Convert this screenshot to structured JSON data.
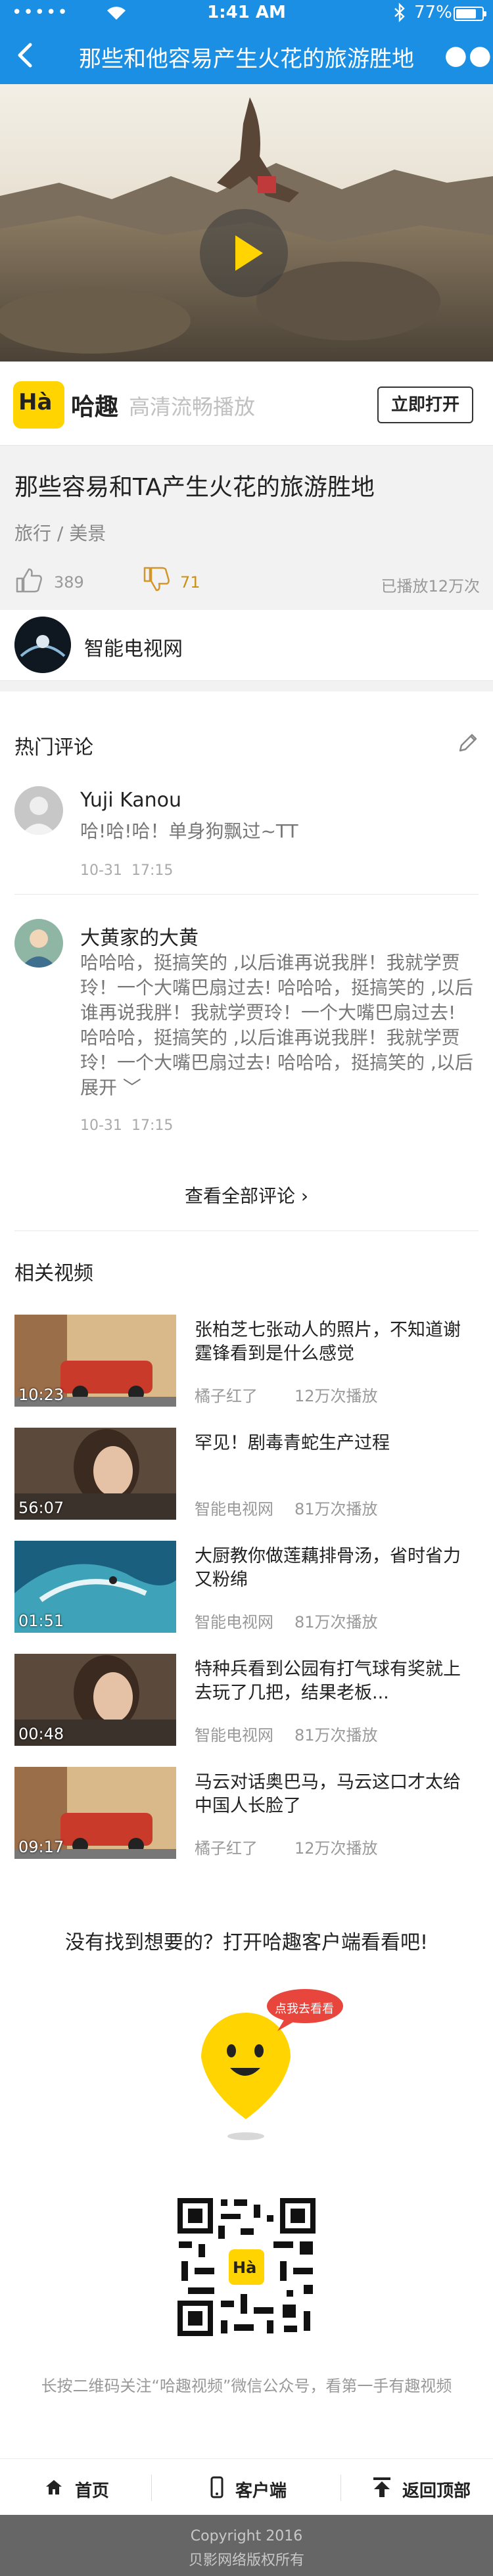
{
  "status_bar": {
    "carrier": "•••••",
    "time": "1:41 AM",
    "battery": "77%"
  },
  "nav": {
    "title": "那些和他容易产生火花的旅游胜地"
  },
  "app_banner": {
    "brand": "哈趣",
    "logo_text": "Hà",
    "slogan": "高清流畅播放",
    "open_label": "立即打开"
  },
  "video_info": {
    "title": "那些容易和TA产生火花的旅游胜地",
    "category": "旅行 / 美景",
    "likes": "389",
    "dislikes": "71",
    "plays": "已播放12万次"
  },
  "channel": {
    "name": "智能电视网"
  },
  "comments": {
    "heading": "热门评论",
    "items": [
      {
        "user": "Yuji Kanou",
        "text": "哈!哈!哈！单身狗飘过~TT",
        "date": "10-31",
        "time": "17:15"
      },
      {
        "user": "大黄家的大黄",
        "text": "哈哈哈，挺搞笑的 ,以后谁再说我胖！我就学贾玲！一个大嘴巴扇过去! 哈哈哈，挺搞笑的 ,以后谁再说我胖！我就学贾玲！一个大嘴巴扇过去!　哈哈哈，挺搞笑的 ,以后谁再说我胖！我就学贾玲！一个大嘴巴扇过去! 哈哈哈，挺搞笑的 ,以后谁再说我胖！",
        "expand": "展开",
        "date": "10-31",
        "time": "17:15"
      }
    ],
    "see_all": "查看全部评论"
  },
  "related": {
    "heading": "相关视频",
    "items": [
      {
        "title": "张柏芝七张动人的照片，不知道谢霆锋看到是什么感觉",
        "duration": "10:23",
        "source": "橘子红了",
        "plays": "12万次播放"
      },
      {
        "title": "罕见！剧毒青蛇生产过程",
        "duration": "56:07",
        "source": "智能电视网",
        "plays": "81万次播放"
      },
      {
        "title": "大厨教你做莲藕排骨汤，省时省力又粉绵",
        "duration": "01:51",
        "source": "智能电视网",
        "plays": "81万次播放"
      },
      {
        "title": "特种兵看到公园有打气球有奖就上去玩了几把，结果老板...",
        "duration": "00:48",
        "source": "智能电视网",
        "plays": "81万次播放"
      },
      {
        "title": "马云对话奥巴马，马云这口才太给中国人长脸了",
        "duration": "09:17",
        "source": "橘子红了",
        "plays": "12万次播放"
      }
    ]
  },
  "promo": {
    "text": "没有找到想要的？打开哈趣客户端看看吧!",
    "bubble": "点我去看看",
    "qr_caption": "长按二维码关注“哈趣视频”微信公众号，看第一手有趣视频"
  },
  "footer_nav": {
    "home": "首页",
    "client": "客户端",
    "top": "返回顶部"
  },
  "copyright": {
    "line1": "Copyright 2016",
    "line2": "贝影网络版权所有"
  },
  "colors": {
    "brand_blue": "#1a8fe3",
    "yellow": "#ffd400"
  }
}
